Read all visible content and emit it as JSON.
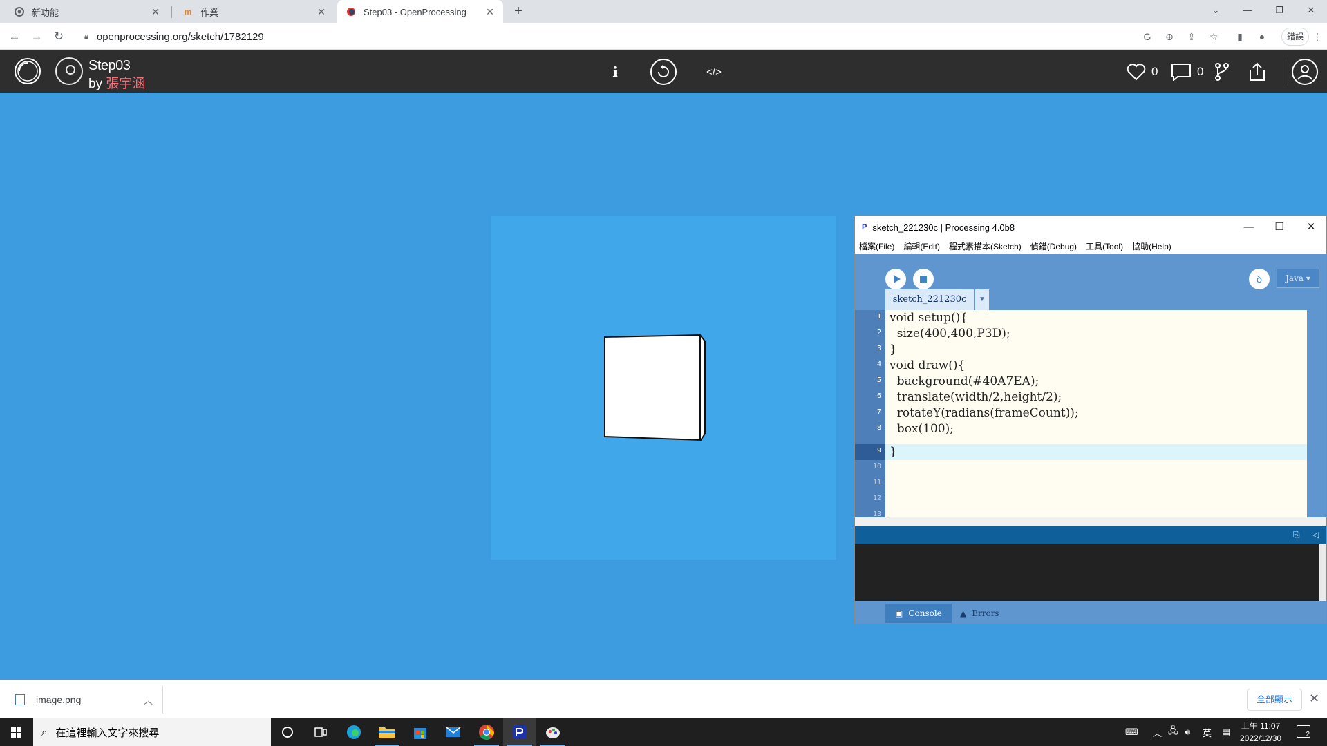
{
  "browser": {
    "tabs": [
      {
        "title": "新功能",
        "icon": "chrome-icon"
      },
      {
        "title": "作業",
        "icon": "moodle-icon"
      },
      {
        "title": "Step03 - OpenProcessing",
        "icon": "openprocessing-icon"
      }
    ],
    "url": "openprocessing.org/sketch/1782129",
    "error_pill": "錯誤"
  },
  "openprocessing": {
    "sketch_title": "Step03",
    "by_label": "by ",
    "author": "張宇涵",
    "info_label": "i",
    "code_label": "</>",
    "like_count": "0",
    "comment_count": "0"
  },
  "ide": {
    "window_title": "sketch_221230c | Processing 4.0b8",
    "app_icon_text": "P",
    "menu": [
      "檔案(File)",
      "編輯(Edit)",
      "程式素描本(Sketch)",
      "偵錯(Debug)",
      "工具(Tool)",
      "協助(Help)"
    ],
    "debug_symbol": "ꝺ",
    "mode": "Java ▾",
    "tab_name": "sketch_221230c",
    "line_numbers": [
      "1",
      "2",
      "3",
      "4",
      "5",
      "6",
      "7",
      "8",
      "9",
      "10",
      "11",
      "12",
      "13"
    ],
    "code_lines": [
      "void setup(){",
      "  size(400,400,P3D);",
      "}",
      "void draw(){",
      "  background(#40A7EA);",
      "  translate(width/2,height/2);",
      "  rotateY(radians(frameCount));",
      "  box(100);",
      "}"
    ],
    "current_line": "9",
    "console_tab": "Console",
    "errors_tab": "Errors"
  },
  "download_shelf": {
    "file_name": "image.png",
    "show_all": "全部顯示"
  },
  "taskbar": {
    "search_placeholder": "在這裡輸入文字來搜尋",
    "ime_label": "英",
    "time": "上午 11:07",
    "date": "2022/12/30",
    "notification_count": "2"
  },
  "colors": {
    "page_bg": "#3d9be0",
    "sketch_bg": "#40A7EA",
    "header_bg": "#2e2e2e",
    "author_color": "#ff6e76"
  }
}
